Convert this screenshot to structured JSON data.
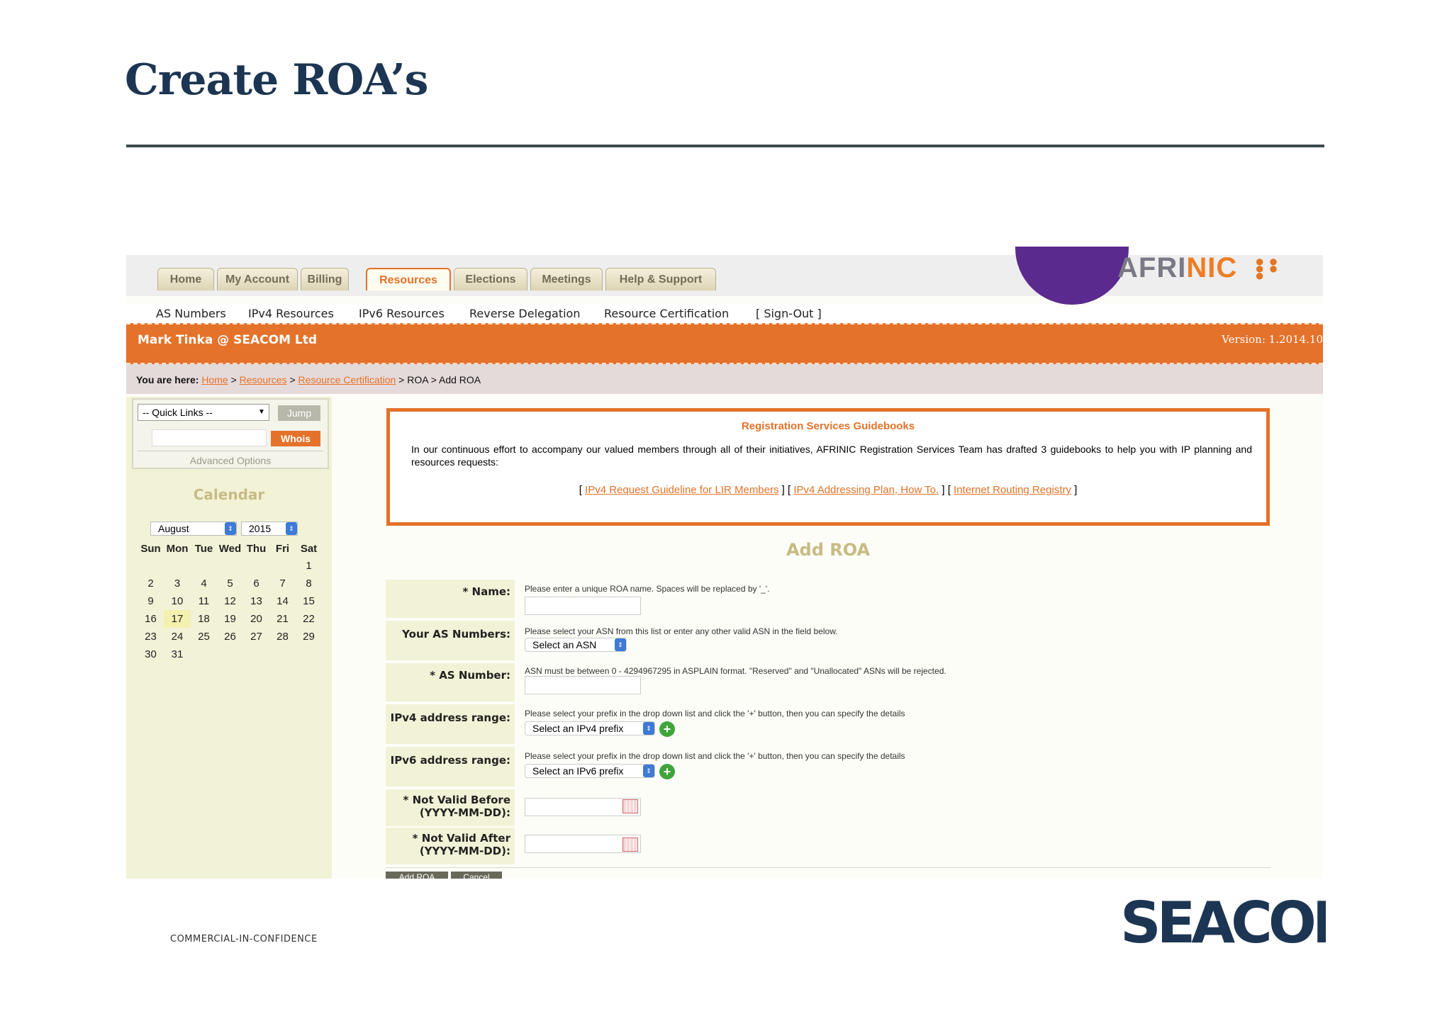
{
  "slide": {
    "title": "Create ROA’s",
    "footer": "COMMERCIAL-IN-CONFIDENCE",
    "brand": "SEACOM"
  },
  "colors": {
    "navy": "#1c3552",
    "orange": "#e5722a",
    "khaki": "#c8bb84",
    "purple": "#5b2a8e"
  },
  "app": {
    "logo": {
      "text_main": "AFRI",
      "text_accent": "NIC"
    },
    "tabs": [
      {
        "label": "Home"
      },
      {
        "label": "My Account"
      },
      {
        "label": "Billing"
      },
      {
        "label": "Resources"
      },
      {
        "label": "Elections"
      },
      {
        "label": "Meetings"
      },
      {
        "label": "Help & Support"
      }
    ],
    "active_tab": "Resources",
    "subnav": [
      {
        "label": "AS Numbers"
      },
      {
        "label": "IPv4 Resources"
      },
      {
        "label": "IPv6 Resources"
      },
      {
        "label": "Reverse Delegation"
      },
      {
        "label": "Resource Certification"
      },
      {
        "label": "[ Sign-Out ]"
      }
    ],
    "banner": {
      "user": "Mark Tinka @ SEACOM Ltd",
      "version": "Version: 1.2014.10"
    },
    "breadcrumb": {
      "prefix": "You are here:",
      "home": "Home",
      "resources": "Resources",
      "cert": "Resource Certification",
      "tail": "> ROA > Add ROA"
    },
    "sidebar": {
      "quick_links": "-- Quick Links --",
      "jump": "Jump",
      "whois": "Whois",
      "advanced": "Advanced Options",
      "calendar_title": "Calendar",
      "month": "August",
      "year": "2015",
      "weekdays": [
        "Sun",
        "Mon",
        "Tue",
        "Wed",
        "Thu",
        "Fri",
        "Sat"
      ],
      "weeks": [
        [
          "",
          "",
          "",
          "",
          "",
          "",
          "1"
        ],
        [
          "2",
          "3",
          "4",
          "5",
          "6",
          "7",
          "8"
        ],
        [
          "9",
          "10",
          "11",
          "12",
          "13",
          "14",
          "15"
        ],
        [
          "16",
          "17",
          "18",
          "19",
          "20",
          "21",
          "22"
        ],
        [
          "23",
          "24",
          "25",
          "26",
          "27",
          "28",
          "29"
        ],
        [
          "30",
          "31",
          "",
          "",
          "",
          "",
          ""
        ]
      ],
      "today": "17"
    },
    "guidebook": {
      "title": "Registration Services Guidebooks",
      "body": "In our continuous effort to accompany our valued members through all of their initiatives, AFRINIC Registration Services Team has drafted 3 guidebooks to help you with IP planning and resources requests:",
      "link1": "IPv4 Request Guideline for LIR Members",
      "link2": "IPv4 Addressing Plan, How To.",
      "link3": "Internet Routing Registry"
    },
    "form": {
      "title": "Add ROA",
      "name_label": "* Name:",
      "name_help": "Please enter a unique ROA name. Spaces will be replaced by '_'.",
      "asns_label": "Your AS Numbers:",
      "asns_help": "Please select your ASN from this list or enter any other valid ASN in the field below.",
      "asns_select": "Select an ASN",
      "asn_label": "* AS Number:",
      "asn_help": "ASN must be between 0 - 4294967295 in ASPLAIN format. \"Reserved\" and \"Unallocated\" ASNs will be rejected.",
      "ipv4_label": "IPv4 address range:",
      "ipv4_help": "Please select your prefix in the drop down list and click the '+' button, then you can specify the details",
      "ipv4_select": "Select an IPv4 prefix",
      "ipv6_label": "IPv6 address range:",
      "ipv6_help": "Please select your prefix in the drop down list and click the '+' button, then you can specify the details",
      "ipv6_select": "Select an IPv6 prefix",
      "nvb_label_1": "* Not Valid Before",
      "nvb_label_2": "(YYYY-MM-DD):",
      "nva_label_1": "* Not Valid After",
      "nva_label_2": "(YYYY-MM-DD):",
      "submit": "Add ROA",
      "cancel": "Cancel"
    }
  }
}
